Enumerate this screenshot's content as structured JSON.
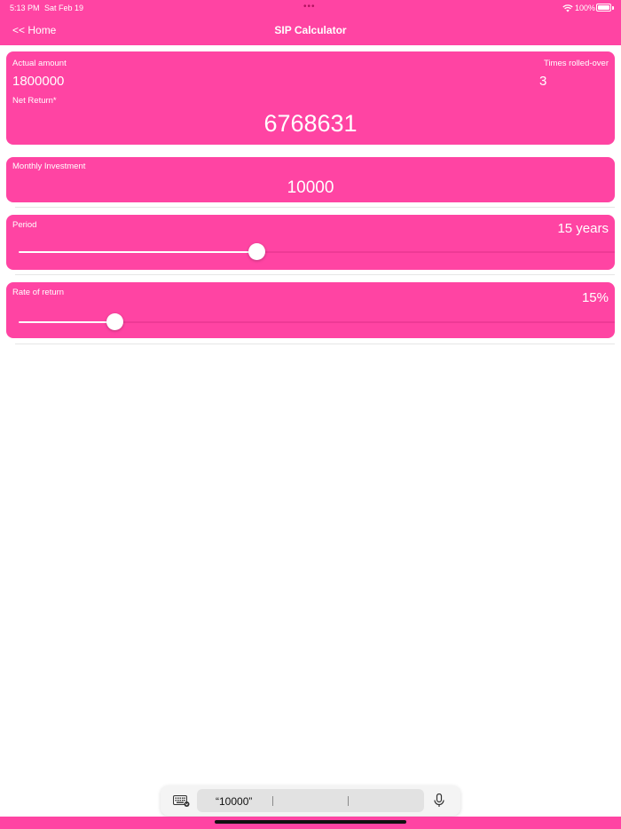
{
  "status_bar": {
    "time": "5:13 PM",
    "date": "Sat Feb 19",
    "battery": "100%"
  },
  "nav": {
    "back_label": "<< Home",
    "title": "SIP Calculator"
  },
  "summary": {
    "actual_amount_label": "Actual amount",
    "actual_amount_value": "1800000",
    "times_rolled_label": "Times rolled-over",
    "times_rolled_value": "3",
    "net_return_label": "Net Return*",
    "net_return_value": "6768631"
  },
  "monthly_investment": {
    "label": "Monthly Investment",
    "value": "10000"
  },
  "period": {
    "label": "Period",
    "value_text": "15 years",
    "slider_fraction": 0.4
  },
  "rate_of_return": {
    "label": "Rate of return",
    "value_text": "15%",
    "slider_fraction": 0.162
  },
  "keyboard_bar": {
    "suggestion": "“10000”"
  },
  "colors": {
    "accent": "#ff44a3",
    "background": "#ffffff"
  }
}
